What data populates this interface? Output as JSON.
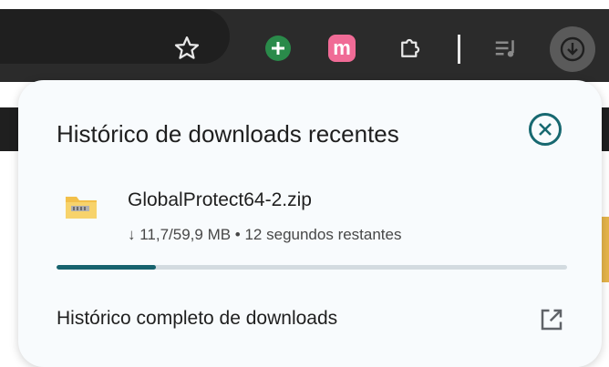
{
  "toolbar": {
    "extensions": [
      {
        "name": "plus-extension",
        "label": "+"
      },
      {
        "name": "m-extension",
        "label": "m"
      }
    ]
  },
  "download_panel": {
    "title": "Histórico de downloads recentes",
    "close_icon": "close-icon",
    "item": {
      "filename": "GlobalProtect64-2.zip",
      "status": "↓ 11,7/59,9 MB • 12 segundos restantes",
      "progress_fraction": 0.195,
      "icon": "zip-folder-icon"
    },
    "footer_link": "Histórico completo de downloads",
    "footer_icon": "open-in-new-icon"
  },
  "colors": {
    "toolbar_bg": "#2b2b2b",
    "accent": "#17636e",
    "popup_bg": "#f8fbfd"
  }
}
